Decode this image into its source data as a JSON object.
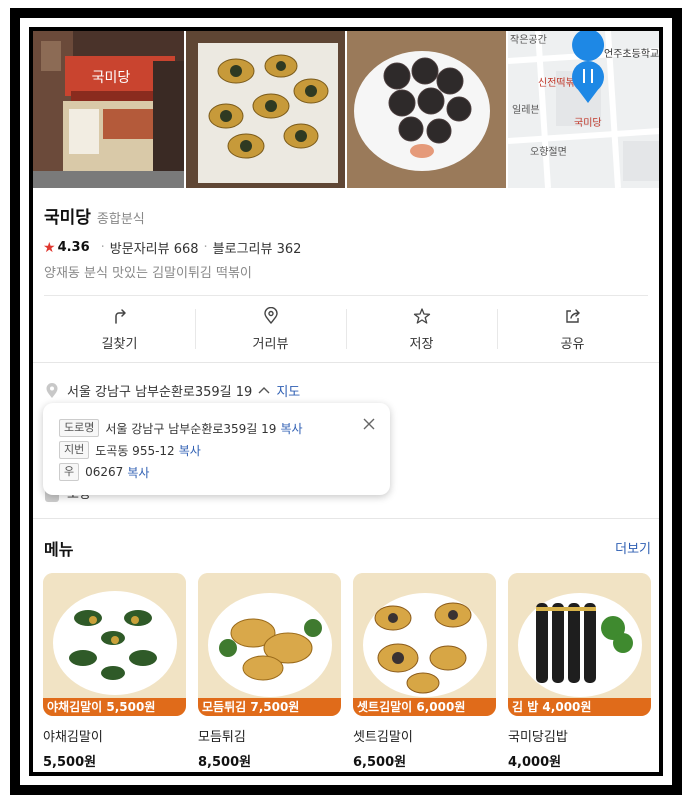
{
  "place": {
    "name": "국미당",
    "category": "종합분식",
    "rating": "4.36",
    "visitor_reviews": "방문자리뷰 668",
    "blog_reviews": "블로그리뷰 362",
    "description": "양재동 분식 맛있는 김말이튀김 떡볶이"
  },
  "map_thumb": {
    "labels": [
      "작은공간",
      "언주초등학교",
      "신전떡볶",
      "일레븐",
      "국미당",
      "오향절면"
    ]
  },
  "storefront_sign": "국미당",
  "actions": [
    {
      "label": "길찾기",
      "icon": "directions-icon"
    },
    {
      "label": "거리뷰",
      "icon": "street-view-pin-icon"
    },
    {
      "label": "저장",
      "icon": "star-icon"
    },
    {
      "label": "공유",
      "icon": "share-icon"
    }
  ],
  "address": {
    "short": "서울 강남구 남부순환로359길 19",
    "map_link": "지도",
    "road_tag": "도로명",
    "road": "서울 강남구 남부순환로359길 19",
    "lot_tag": "지번",
    "lot": "도곡동 955-12",
    "zip_tag": "우",
    "zip": "06267",
    "copy": "복사",
    "behind_text": "포장"
  },
  "menu": {
    "title": "메뉴",
    "more": "더보기",
    "items": [
      {
        "name": "야채김말이",
        "price": "5,500원",
        "banner": "야채김말이 5,500원"
      },
      {
        "name": "모듬튀김",
        "price": "8,500원",
        "banner": "모듬튀김 7,500원"
      },
      {
        "name": "셋트김말이",
        "price": "6,500원",
        "banner": "셋트김말이 6,000원"
      },
      {
        "name": "국미당김밥",
        "price": "4,000원",
        "banner": "김 밥 4,000원"
      }
    ]
  },
  "colors": {
    "accent_blue": "#2f5fb3",
    "star_red": "#e0372f",
    "map_pin": "#1e88e5",
    "food_orange": "#e06b1a"
  }
}
